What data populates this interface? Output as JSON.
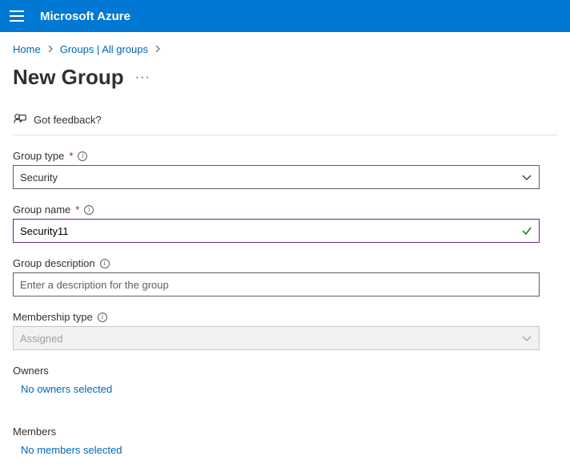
{
  "header": {
    "brand": "Microsoft Azure"
  },
  "breadcrumb": {
    "items": [
      "Home",
      "Groups | All groups"
    ]
  },
  "title": "New Group",
  "feedback": {
    "label": "Got feedback?"
  },
  "form": {
    "group_type": {
      "label": "Group type",
      "value": "Security",
      "required": true
    },
    "group_name": {
      "label": "Group name",
      "value": "Security11",
      "required": true
    },
    "group_description": {
      "label": "Group description",
      "placeholder": "Enter a description for the group",
      "value": ""
    },
    "membership_type": {
      "label": "Membership type",
      "value": "Assigned",
      "disabled": true
    },
    "owners": {
      "label": "Owners",
      "link": "No owners selected"
    },
    "members": {
      "label": "Members",
      "link": "No members selected"
    }
  }
}
